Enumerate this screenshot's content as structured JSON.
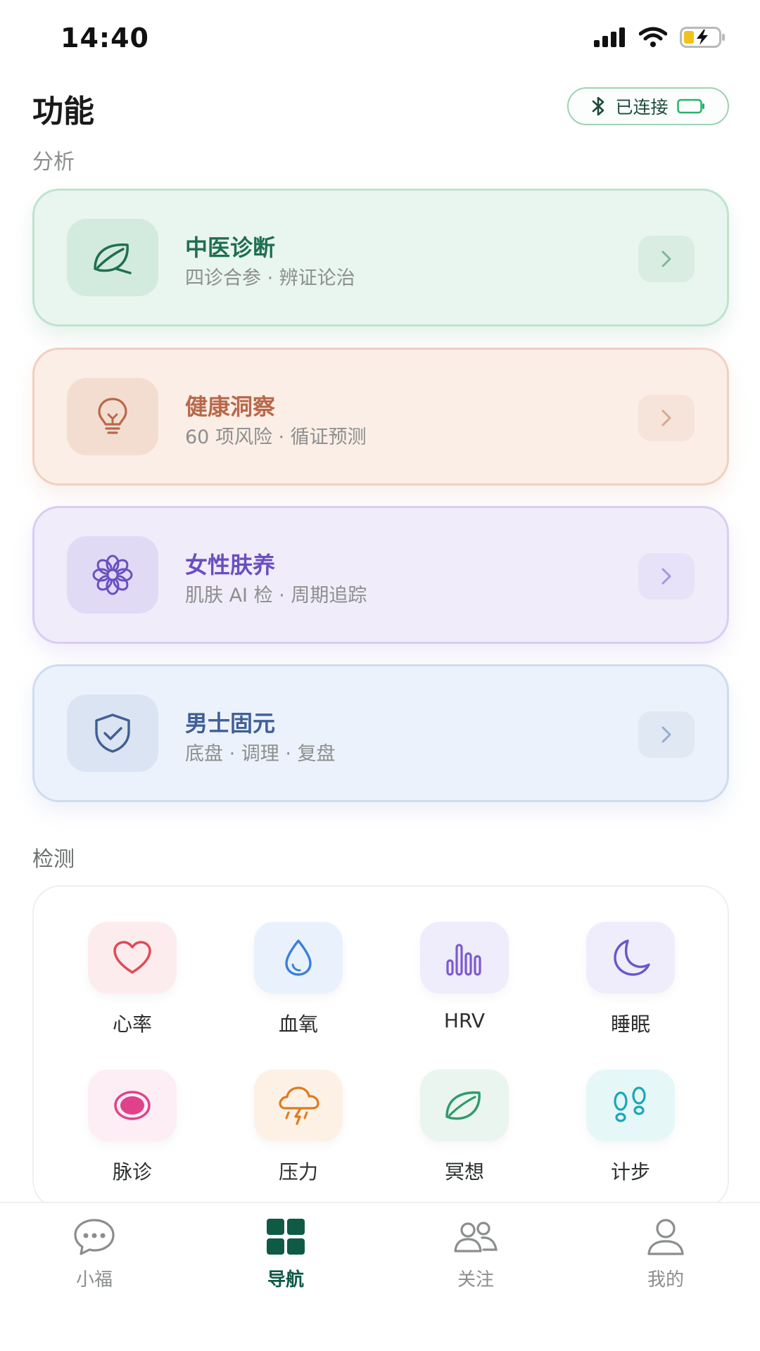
{
  "status_bar": {
    "time": "14:40"
  },
  "header": {
    "title": "功能",
    "bluetooth_label": "已连接"
  },
  "sections": {
    "analysis": "分析",
    "detection": "检测"
  },
  "cards": [
    {
      "title": "中医诊断",
      "subtitle": "四诊合参 · 辨证论治",
      "icon": "leaf-icon",
      "accent": "#1f6f52"
    },
    {
      "title": "健康洞察",
      "subtitle": "60 项风险 · 循证预测",
      "icon": "lightbulb-icon",
      "accent": "#b8694b"
    },
    {
      "title": "女性肤养",
      "subtitle": "肌肤 AI 检 · 周期追踪",
      "icon": "flower-icon",
      "accent": "#6a4fc0"
    },
    {
      "title": "男士固元",
      "subtitle": "底盘 · 调理 · 复盘",
      "icon": "shield-check-icon",
      "accent": "#3f5f95"
    }
  ],
  "detect_items": [
    {
      "label": "心率",
      "icon": "heart-icon"
    },
    {
      "label": "血氧",
      "icon": "droplet-icon"
    },
    {
      "label": "HRV",
      "icon": "bar-chart-icon"
    },
    {
      "label": "睡眠",
      "icon": "moon-icon"
    },
    {
      "label": "脉诊",
      "icon": "pulse-dot-icon"
    },
    {
      "label": "压力",
      "icon": "storm-cloud-icon"
    },
    {
      "label": "冥想",
      "icon": "leaf-icon"
    },
    {
      "label": "计步",
      "icon": "footprints-icon"
    }
  ],
  "tabs": [
    {
      "label": "小福",
      "icon": "chat-bubble-icon",
      "active": false
    },
    {
      "label": "导航",
      "icon": "grid-icon",
      "active": true
    },
    {
      "label": "关注",
      "icon": "people-icon",
      "active": false
    },
    {
      "label": "我的",
      "icon": "person-icon",
      "active": false
    }
  ],
  "colors": {
    "brand": "#0e5a45",
    "connected_border": "#9fd0b5"
  }
}
